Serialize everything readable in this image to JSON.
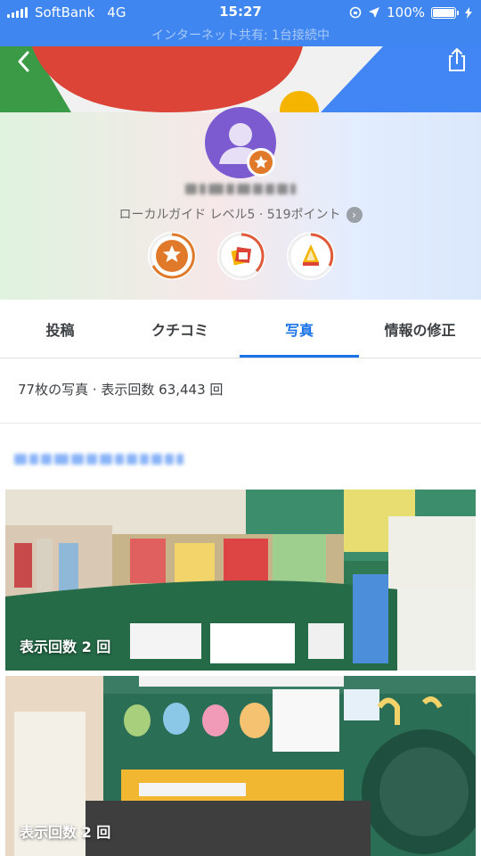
{
  "status_bar": {
    "carrier": "SoftBank",
    "network": "4G",
    "time": "15:27",
    "battery": "100%",
    "hotspot": "インターネット共有: 1台接続中"
  },
  "profile": {
    "level_line": "ローカルガイド レベル5 · 519ポイント"
  },
  "tabs": [
    {
      "label": "投稿"
    },
    {
      "label": "クチコミ"
    },
    {
      "label": "写真"
    },
    {
      "label": "情報の修正"
    }
  ],
  "summary": "77枚の写真 · 表示回数 63,443 回",
  "photos": [
    {
      "caption": "表示回数 2 回"
    },
    {
      "caption": "表示回数 2 回"
    }
  ],
  "colors": {
    "accent": "#1a73e8",
    "status_bar": "#3f86f0",
    "avatar": "#7c5ad0",
    "badge": "#e07a2a"
  },
  "icons": [
    "back-icon",
    "share-icon",
    "avatar-icon",
    "star-badge-icon",
    "chevron-right-icon"
  ]
}
